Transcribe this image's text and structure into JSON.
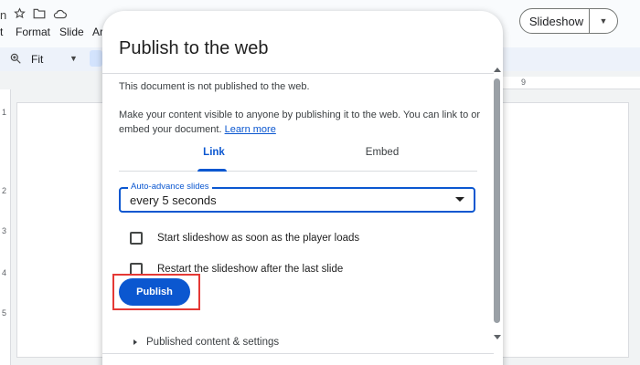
{
  "app": {
    "title_fragment": "n",
    "menu": [
      {
        "label": "t"
      },
      {
        "label": "Format"
      },
      {
        "label": "Slide"
      },
      {
        "label": "Ar"
      }
    ],
    "slideshow_label": "Slideshow",
    "zoom_label": "Fit",
    "ruler_top_tick": "9",
    "ruler_left_ticks": [
      "1",
      "2",
      "3",
      "4",
      "5"
    ]
  },
  "dialog": {
    "title": "Publish to the web",
    "status": "This document is not published to the web.",
    "description": "Make your content visible to anyone by publishing it to the web. You can link to or embed your document.",
    "learn_more": "Learn more",
    "tabs": [
      {
        "label": "Link",
        "active": true
      },
      {
        "label": "Embed",
        "active": false
      }
    ],
    "auto_advance": {
      "label": "Auto-advance slides",
      "value": "every 5 seconds"
    },
    "options": [
      {
        "label": "Start slideshow as soon as the player loads",
        "checked": false
      },
      {
        "label": "Restart the slideshow after the last slide",
        "checked": false
      }
    ],
    "publish_label": "Publish",
    "settings_label": "Published content & settings"
  },
  "colors": {
    "accent": "#0b57d0",
    "highlight": "#e53935"
  }
}
